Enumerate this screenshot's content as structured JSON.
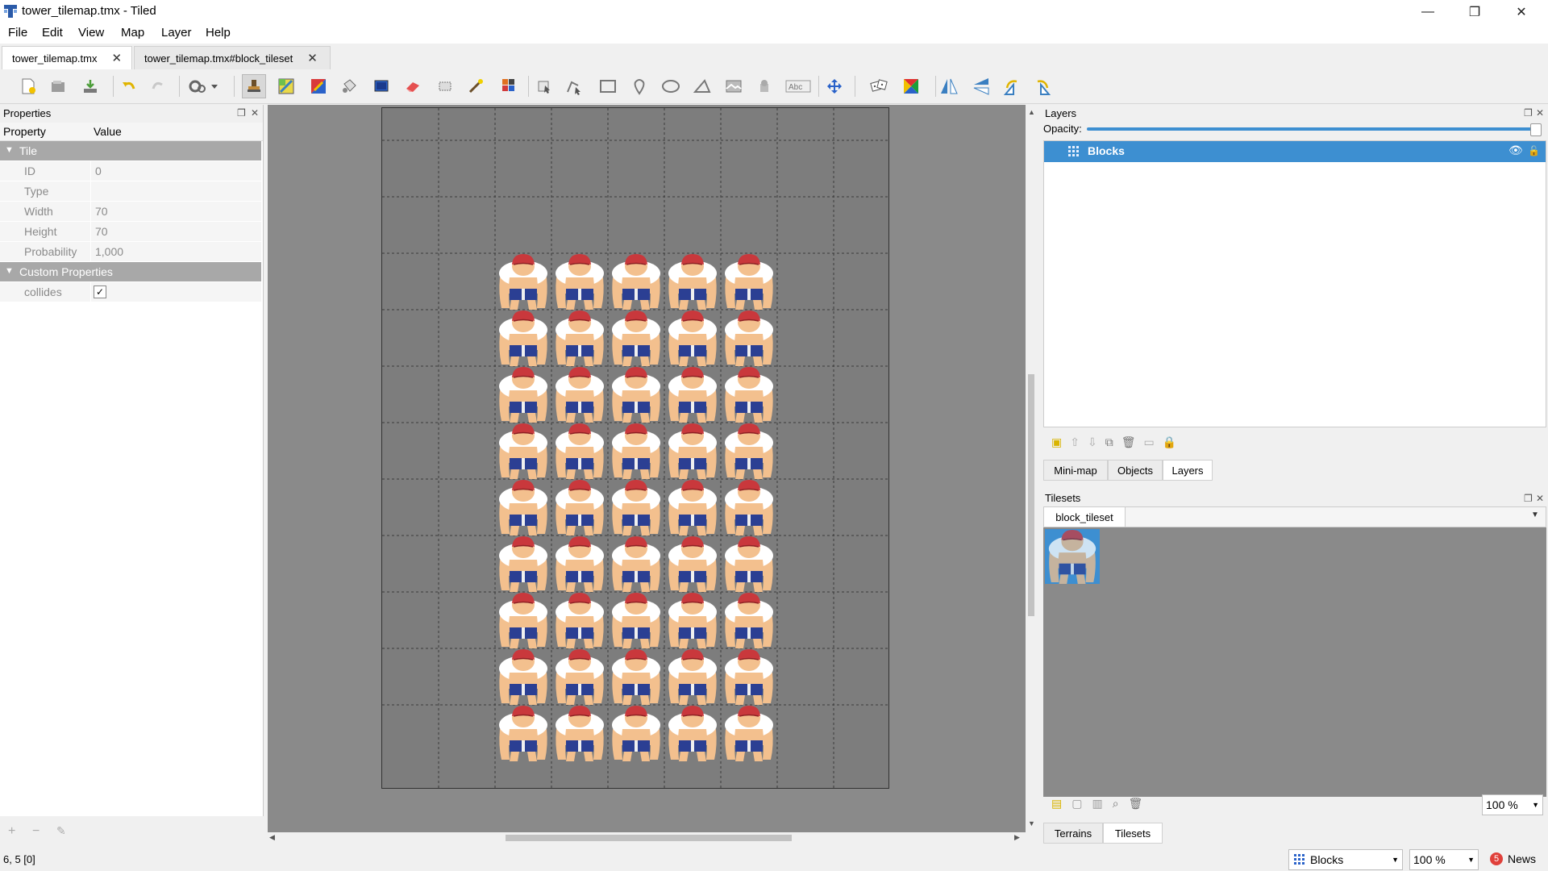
{
  "window": {
    "title": "tower_tilemap.tmx - Tiled",
    "minimize_glyph": "—",
    "maximize_glyph": "❐",
    "close_glyph": "✕"
  },
  "menu": [
    {
      "label": "File",
      "hotkey": "F"
    },
    {
      "label": "Edit",
      "hotkey": "E"
    },
    {
      "label": "View",
      "hotkey": "V"
    },
    {
      "label": "Map",
      "hotkey": "M"
    },
    {
      "label": "Layer",
      "hotkey": "L"
    },
    {
      "label": "Help",
      "hotkey": "H"
    }
  ],
  "tabs": [
    {
      "label": "tower_tilemap.tmx",
      "active": true
    },
    {
      "label": "tower_tilemap.tmx#block_tileset",
      "active": false
    }
  ],
  "toolbar": {
    "icons": [
      "new-file-icon",
      "open-file-icon",
      "save-icon",
      "undo-icon",
      "redo-icon",
      "commands-icon",
      "stamp-brush-icon",
      "terrain-brush-icon",
      "wang-brush-icon",
      "bucket-fill-icon",
      "shape-fill-icon",
      "eraser-icon",
      "rect-select-icon",
      "magic-wand-icon",
      "select-same-tile-icon",
      "select-objects-icon",
      "edit-polygons-icon",
      "insert-rectangle-icon",
      "insert-point-icon",
      "insert-ellipse-icon",
      "insert-polygon-icon",
      "insert-tile-icon",
      "insert-template-icon",
      "insert-text-icon",
      "move-tool-icon",
      "random-mode-icon",
      "wang-fill-icon",
      "flip-horizontal-icon",
      "flip-vertical-icon",
      "rotate-left-icon",
      "rotate-right-icon"
    ]
  },
  "properties": {
    "panel_title": "Properties",
    "col_property": "Property",
    "col_value": "Value",
    "group_tile": "Tile",
    "rows": [
      {
        "key": "ID",
        "value": "0"
      },
      {
        "key": "Type",
        "value": ""
      },
      {
        "key": "Width",
        "value": "70"
      },
      {
        "key": "Height",
        "value": "70"
      },
      {
        "key": "Probability",
        "value": "1,000"
      }
    ],
    "group_custom": "Custom Properties",
    "custom_rows": [
      {
        "key": "collides",
        "checked": true
      }
    ]
  },
  "map": {
    "cols": 9,
    "rows": 12,
    "filled_cols": [
      2,
      3,
      4,
      5,
      6
    ],
    "filled_row_start": 3
  },
  "layers_panel": {
    "title": "Layers",
    "opacity_label": "Opacity:",
    "opacity": 1.0,
    "layer_name": "Blocks",
    "tabs": [
      "Mini-map",
      "Objects",
      "Layers"
    ],
    "active_tab": "Layers"
  },
  "tilesets_panel": {
    "title": "Tilesets",
    "tileset_name": "block_tileset",
    "zoom": "100 %",
    "tabs": [
      "Terrains",
      "Tilesets"
    ],
    "active_tab": "Tilesets"
  },
  "status": {
    "coords": "6, 5 [0]",
    "layer": "Blocks",
    "zoom": "100 %",
    "news_count": "5",
    "news_label": "News"
  },
  "colors": {
    "accent": "#3d8fd1",
    "selected_layer": "#3d8fd1",
    "canvas_bg": "#8a8a8a",
    "map_bg": "#7d7d7d"
  }
}
